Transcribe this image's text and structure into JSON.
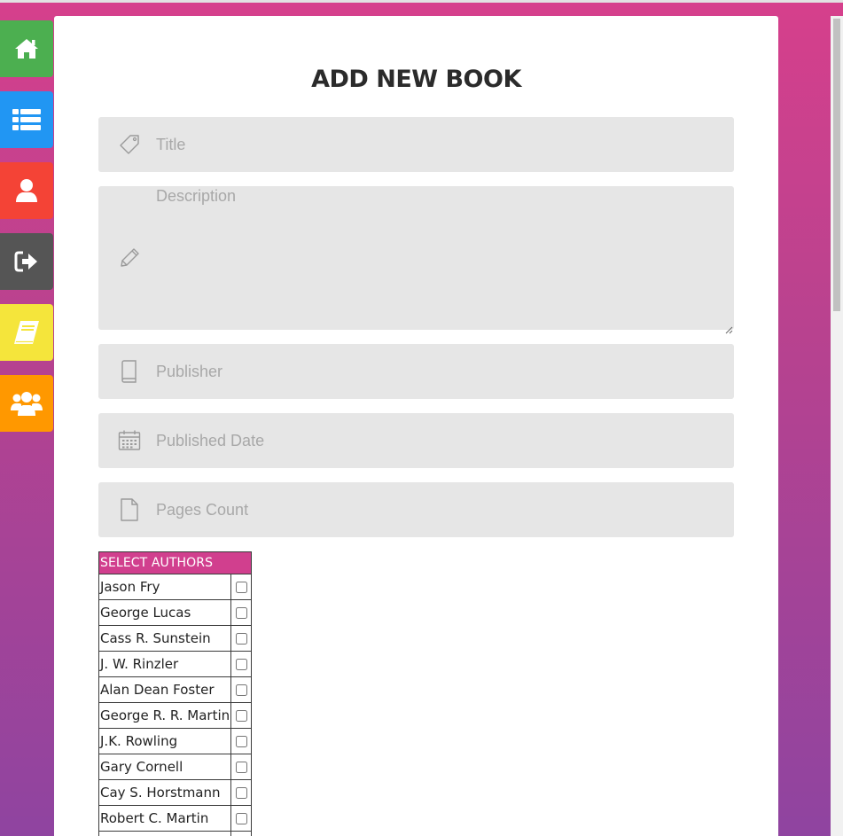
{
  "colors": {
    "home": "#4caf50",
    "list": "#2196f3",
    "profile": "#f44336",
    "logout": "#555555",
    "books": "#f5e53b",
    "users": "#ff9800",
    "accent": "#d13f8e"
  },
  "nav": [
    {
      "name": "nav-home",
      "icon": "home-icon"
    },
    {
      "name": "nav-list",
      "icon": "list-icon"
    },
    {
      "name": "nav-profile",
      "icon": "user-icon"
    },
    {
      "name": "nav-logout",
      "icon": "sign-out-icon"
    },
    {
      "name": "nav-books",
      "icon": "book-icon"
    },
    {
      "name": "nav-users",
      "icon": "users-icon"
    }
  ],
  "form": {
    "title": "ADD NEW BOOK",
    "title_placeholder": "Title",
    "description_placeholder": "Description",
    "publisher_placeholder": "Publisher",
    "published_date_placeholder": "Published Date",
    "pages_count_placeholder": "Pages Count"
  },
  "authors": {
    "header": "SELECT AUTHORS",
    "rows": [
      {
        "name": "Jason Fry",
        "checked": false
      },
      {
        "name": "George Lucas",
        "checked": false
      },
      {
        "name": "Cass R. Sunstein",
        "checked": false
      },
      {
        "name": "J. W. Rinzler",
        "checked": false
      },
      {
        "name": "Alan Dean Foster",
        "checked": false
      },
      {
        "name": "George R. R. Martin",
        "checked": false
      },
      {
        "name": "J.K. Rowling",
        "checked": false
      },
      {
        "name": "Gary Cornell",
        "checked": false
      },
      {
        "name": "Cay S. Horstmann",
        "checked": false
      },
      {
        "name": "Robert C. Martin",
        "checked": false
      }
    ]
  }
}
